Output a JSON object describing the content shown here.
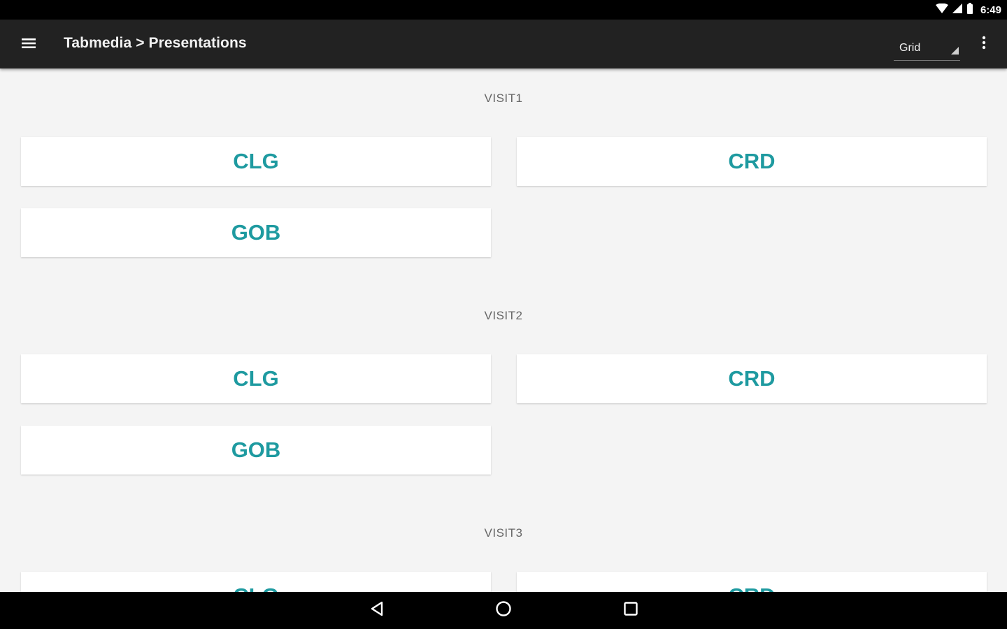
{
  "status_bar": {
    "time": "6:49",
    "icons": [
      "wifi-icon",
      "signal-icon",
      "battery-icon"
    ]
  },
  "app_bar": {
    "menu_icon": "hamburger-menu-icon",
    "title": "Tabmedia > Presentations",
    "view_select": {
      "selected": "Grid"
    },
    "overflow_icon": "more-vert-icon"
  },
  "sections": [
    {
      "title": "VISIT1",
      "items": [
        {
          "label": "CLG"
        },
        {
          "label": "CRD"
        },
        {
          "label": "GOB"
        }
      ]
    },
    {
      "title": "VISIT2",
      "items": [
        {
          "label": "CLG"
        },
        {
          "label": "CRD"
        },
        {
          "label": "GOB"
        }
      ]
    },
    {
      "title": "VISIT3",
      "items": [
        {
          "label": "CLG"
        },
        {
          "label": "CRD"
        }
      ]
    }
  ],
  "nav_bar": {
    "icons": [
      "back-icon",
      "home-icon",
      "recents-icon"
    ]
  },
  "colors": {
    "accent": "#1e9aa0",
    "app_bar": "#222222",
    "background": "#f4f4f4",
    "tile": "#ffffff"
  }
}
